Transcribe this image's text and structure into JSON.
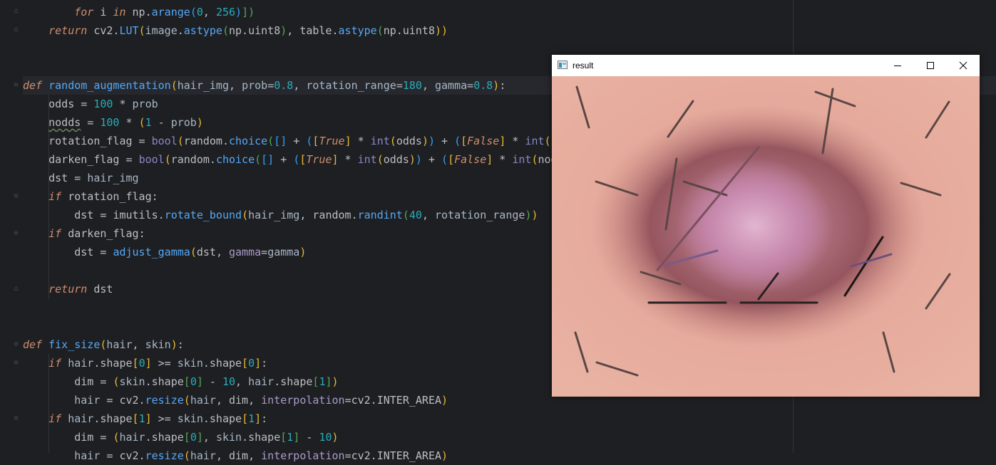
{
  "editor": {
    "lines": [
      {
        "id": "l0"
      },
      {
        "id": "l1"
      }
    ],
    "tokens": {
      "for": "for",
      "i": " i ",
      "in": "in",
      "np": " np.",
      "arange": "arange",
      "args0": "(",
      "zero": "0",
      "comma": ", ",
      "n256": "256",
      "close0": ")",
      "close1": "])",
      "return": "return",
      "cv2": " cv2.",
      "LUT": "LUT",
      "lp": "(",
      "image": "image",
      "dot": ".",
      "astype": "astype",
      "lp2": "(",
      "np2": "np.",
      "uint8": "uint8",
      "rp": ")",
      "comma2": ", ",
      "table": "table.",
      "astype2": "astype",
      "lp3": "(",
      "np3": "np.",
      "uint8b": "uint8",
      "rp3": "))",
      "def": "def",
      "random_augmentation": "random_augmentation",
      "hair_img": "hair_img",
      "prob": "prob",
      "eq08": "=",
      "v08": "0.8",
      "rotation_range": "rotation_range",
      "eq180": "=",
      "v180": "180",
      "gamma": "gamma",
      "eqg": "=",
      "vg": "0.8",
      "colon": ":",
      "odds": "odds",
      "eq": " = ",
      "n100": "100",
      "mul": " * ",
      "probv": "prob",
      "nodds": "nodds",
      "one": "1",
      "minus": " - ",
      "rotation_flag": "rotation_flag",
      "bool": "bool",
      "random": "random.",
      "choice": "choice",
      "empty": "[]",
      "plus": " + ",
      "True": "True",
      "int": "int",
      "False": "False",
      "darken_flag": "darken_flag",
      "dst": "dst",
      "if": "if",
      "imutils": "imutils.",
      "rotate_bound": "rotate_bound",
      "randint": "randint",
      "n40": "40",
      "adjust_gamma": "adjust_gamma",
      "fix_size": "fix_size",
      "hair": "hair",
      "skin": "skin",
      "shape": "shape",
      "ge": " >= ",
      "dim": "dim",
      "n10": "10",
      "resize": "resize",
      "interpolation": "interpolation",
      "INTER_AREA": "cv2.INTER_AREA"
    }
  },
  "window": {
    "title": "result",
    "icon": "opencv-window-icon",
    "controls": [
      "minimize-icon",
      "maximize-icon",
      "close-icon"
    ]
  },
  "colors": {
    "editor_bg": "#1e1f22",
    "keyword": "#cf8e6d",
    "function": "#56a8f5",
    "number": "#2aacb8",
    "skin": "#e3a596",
    "lesion": "#9c5a66"
  }
}
